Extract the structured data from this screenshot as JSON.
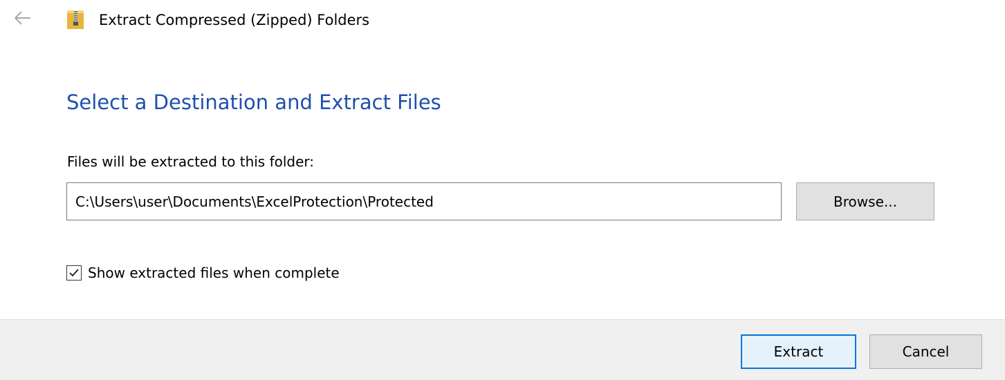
{
  "window": {
    "title": "Extract Compressed (Zipped) Folders",
    "icons": {
      "back": "left-arrow-icon",
      "app": "zipped-folder-icon"
    }
  },
  "main": {
    "heading": "Select a Destination and Extract Files",
    "destination_label": "Files will be extracted to this folder:",
    "destination_path": "C:\\Users\\user\\Documents\\ExcelProtection\\Protected",
    "browse_label": "Browse...",
    "show_files": {
      "label": "Show extracted files when complete",
      "checked": true
    }
  },
  "footer": {
    "extract_label": "Extract",
    "cancel_label": "Cancel"
  },
  "colors": {
    "heading": "#1f4fb0",
    "footer_bg": "#f0f0f0",
    "button_bg": "#e1e1e1",
    "default_button_border": "#0078d7",
    "default_button_bg": "#e5f1fb"
  }
}
